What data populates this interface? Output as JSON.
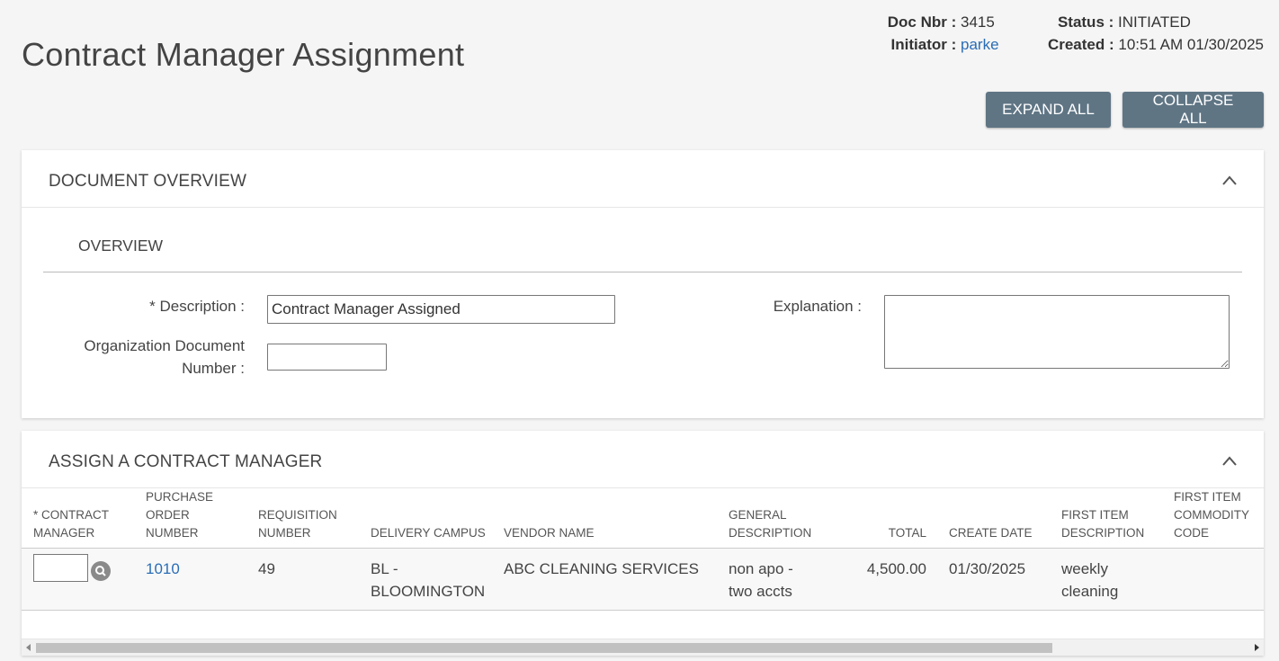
{
  "page": {
    "title": "Contract Manager Assignment"
  },
  "doc_meta": {
    "doc_nbr_label": "Doc Nbr :",
    "doc_nbr": "3415",
    "initiator_label": "Initiator :",
    "initiator": "parke",
    "status_label": "Status :",
    "status": "INITIATED",
    "created_label": "Created :",
    "created": "10:51 AM 01/30/2025"
  },
  "toolbar": {
    "expand_all": "EXPAND ALL",
    "collapse_all": "COLLAPSE ALL"
  },
  "document_overview": {
    "heading": "DOCUMENT OVERVIEW",
    "subheading": "OVERVIEW",
    "description_label": "* Description :",
    "description_value": "Contract Manager Assigned",
    "org_doc_label_line1": "Organization Document",
    "org_doc_label_line2": "Number :",
    "org_doc_value": "",
    "explanation_label": "Explanation :",
    "explanation_value": ""
  },
  "assign": {
    "heading": "ASSIGN A CONTRACT MANAGER",
    "columns": [
      "* CONTRACT MANAGER",
      "PURCHASE ORDER NUMBER",
      "REQUISITION NUMBER",
      "DELIVERY CAMPUS",
      "VENDOR NAME",
      "GENERAL DESCRIPTION",
      "TOTAL",
      "CREATE DATE",
      "FIRST ITEM DESCRIPTION",
      "FIRST ITEM COMMODITY CODE"
    ],
    "rows": [
      {
        "contract_manager": "",
        "purchase_order_number": "1010",
        "requisition_number": "49",
        "delivery_campus": "BL - BLOOMINGTON",
        "vendor_name": "ABC CLEANING SERVICES",
        "general_description": "non apo - two accts",
        "total": "4,500.00",
        "create_date": "01/30/2025",
        "first_item_description": "weekly cleaning",
        "first_item_commodity_code": ""
      }
    ]
  },
  "icons": {
    "collapse": "chevron-up-icon",
    "lookup": "search-icon"
  }
}
